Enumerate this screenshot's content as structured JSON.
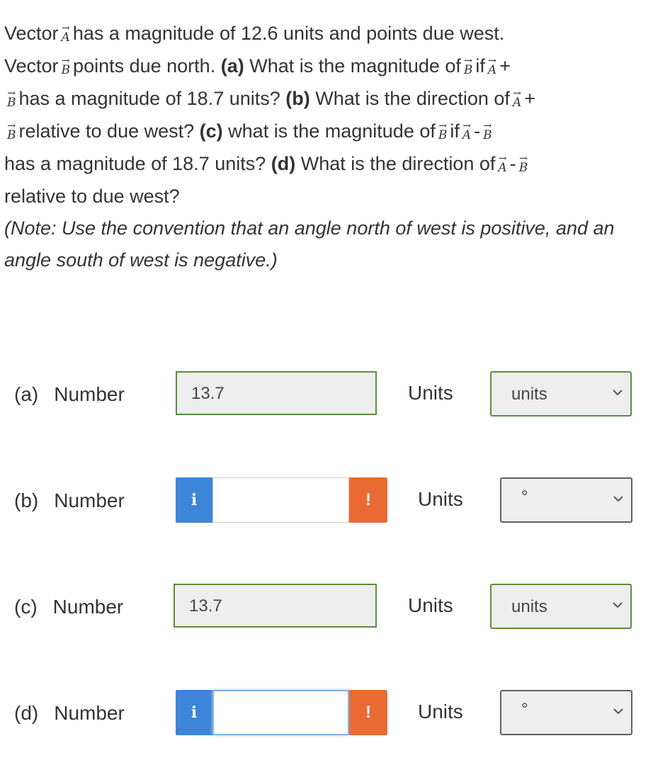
{
  "question": {
    "t1": "Vector",
    "vec_a": "A",
    "vec_b": "B",
    "t2": "has a magnitude of 12.6 units and points due west.",
    "t3": "Vector",
    "t4": "points due north.",
    "pa": "(a)",
    "t5": "What is the magnitude of",
    "t_if": "if",
    "t_plus": "+",
    "t6": "has a magnitude of 18.7 units?",
    "pb": "(b)",
    "t7": "What is the direction of",
    "t8": "relative to due west?",
    "pc": "(c)",
    "t9": "what is the magnitude of",
    "t_minus": "-",
    "t10": "has a magnitude of 18.7 units?",
    "pd": "(d)",
    "t11": "What is the direction of",
    "t12": "relative to due west?",
    "note": "(Note: Use the convention that an angle north of west is positive, and an angle south of west is negative.)"
  },
  "rows": [
    {
      "part": "(a)",
      "number_label": "Number",
      "value": "13.7",
      "units_label": "Units",
      "units_value": "units"
    },
    {
      "part": "(b)",
      "number_label": "Number",
      "value": "",
      "units_label": "Units",
      "units_value": "°"
    },
    {
      "part": "(c)",
      "number_label": "Number",
      "value": "13.7",
      "units_label": "Units",
      "units_value": "units"
    },
    {
      "part": "(d)",
      "number_label": "Number",
      "value": "",
      "units_label": "Units",
      "units_value": "°"
    }
  ],
  "icons": {
    "info": "i",
    "warning": "!"
  },
  "colors": {
    "correct_border": "#5a8f3b",
    "info_blue": "#3d85d8",
    "warning_orange": "#ea6a33"
  }
}
